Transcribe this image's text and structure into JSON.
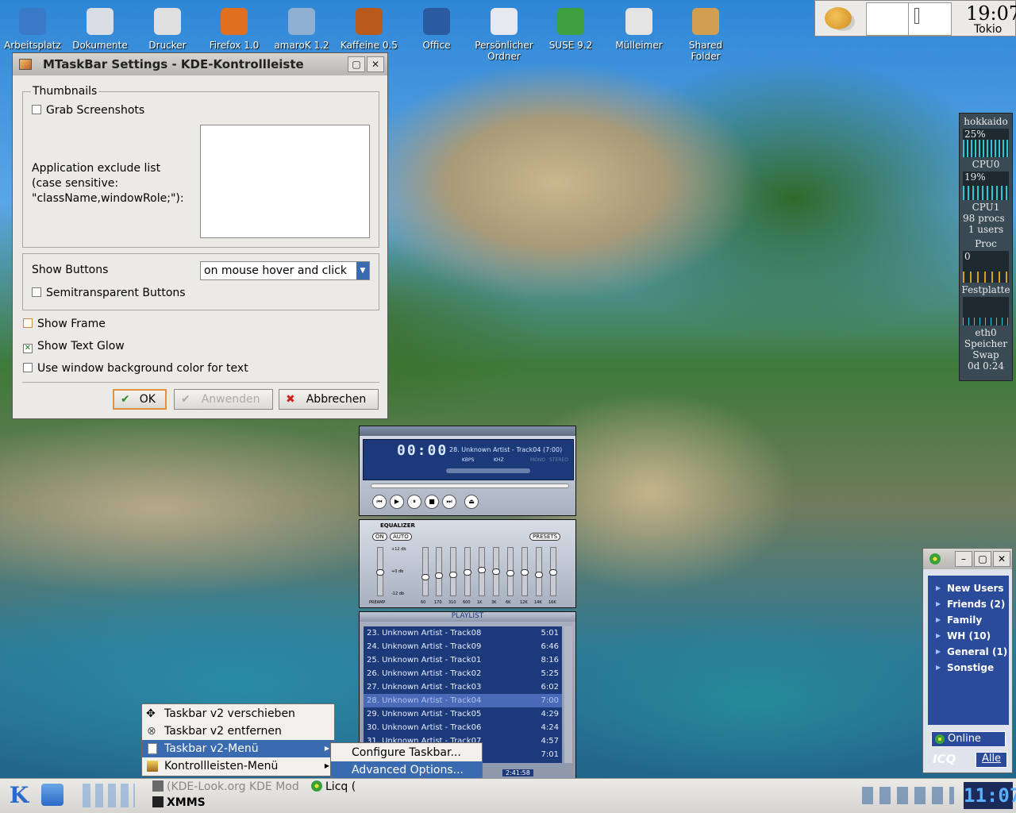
{
  "desktop_icons": [
    {
      "label": "Arbeitsplatz",
      "icon": "computer-icon",
      "color": "#3a78c8"
    },
    {
      "label": "Dokumente",
      "icon": "documents-icon",
      "color": "#d8dde6"
    },
    {
      "label": "Drucker",
      "icon": "printer-icon",
      "color": "#e0e0e0"
    },
    {
      "label": "Firefox 1.0",
      "icon": "firefox-icon",
      "color": "#e07020"
    },
    {
      "label": "amaroK 1.2",
      "icon": "amarok-icon",
      "color": "#8fb0d0"
    },
    {
      "label": "Kaffeine 0.5",
      "icon": "kaffeine-icon",
      "color": "#b85a1a"
    },
    {
      "label": "Office",
      "icon": "office-icon",
      "color": "#2a5aa0"
    },
    {
      "label": "Persönlicher Ordner",
      "icon": "home-icon",
      "color": "#e8e8f0"
    },
    {
      "label": "SUSE 9.2",
      "icon": "suse-icon",
      "color": "#3fa03f"
    },
    {
      "label": "Mülleimer",
      "icon": "trash-icon",
      "color": "#e4e4e4"
    },
    {
      "label": "Shared Folder",
      "icon": "shared-folder-icon",
      "color": "#d0a050"
    }
  ],
  "top_clock": {
    "time": "19:07",
    "city": "Tokio"
  },
  "dialog": {
    "title": "MTaskBar Settings - KDE-Kontrollleiste",
    "thumbnails_legend": "Thumbnails",
    "grab_screenshots": "Grab Screenshots",
    "exclude_label_1": "Application exclude list",
    "exclude_label_2": "(case sensitive:",
    "exclude_label_3": "\"className,windowRole;\"):",
    "show_buttons_label": "Show Buttons",
    "show_buttons_value": "on mouse hover and click",
    "semitransparent": "Semitransparent Buttons",
    "show_frame": "Show Frame",
    "show_text_glow": "Show Text Glow",
    "use_window_bg": "Use window background color for text",
    "ok": "OK",
    "apply": "Anwenden",
    "cancel": "Abbrechen"
  },
  "monitor": {
    "host": "hokkaido",
    "cpu0_pct": "25%",
    "cpu0": "CPU0",
    "cpu1_pct": "19%",
    "cpu1": "CPU1",
    "procs": "98 procs",
    "users": "1 users",
    "proc": "Proc",
    "disk_val": "0",
    "disk": "Festplatte",
    "net": "eth0",
    "mem": "Speicher",
    "swap": "Swap",
    "uptime": "0d 0:24"
  },
  "xmms": {
    "time": "00:00",
    "song": "28. Unknown Artist - Track04 (7:00)",
    "kbps": "KBPS",
    "khz": "KHZ",
    "mono": "MONO",
    "stereo": "STEREO",
    "eq_title": "EQUALIZER",
    "eq_on": "ON",
    "eq_auto": "AUTO",
    "eq_presets": "PRESETS",
    "eq_plus": "+12 db",
    "eq_zero": "+0 db",
    "eq_minus": "-12 db",
    "eq_preamp": "PREAMP",
    "eq_bands": [
      "60",
      "170",
      "310",
      "600",
      "1K",
      "3K",
      "6K",
      "12K",
      "14K",
      "16K"
    ],
    "eq_levels": [
      0.5,
      0.38,
      0.42,
      0.45,
      0.5,
      0.55,
      0.52,
      0.48,
      0.5,
      0.45,
      0.5
    ],
    "playlist_title": "PLAYLIST",
    "playlist": [
      {
        "title": "23. Unknown Artist - Track08",
        "len": "5:01"
      },
      {
        "title": "24. Unknown Artist - Track09",
        "len": "6:46"
      },
      {
        "title": "25. Unknown Artist - Track01",
        "len": "8:16"
      },
      {
        "title": "26. Unknown Artist - Track02",
        "len": "5:25"
      },
      {
        "title": "27. Unknown Artist - Track03",
        "len": "6:02"
      },
      {
        "title": "28. Unknown Artist - Track04",
        "len": "7:00"
      },
      {
        "title": "29. Unknown Artist - Track05",
        "len": "4:29"
      },
      {
        "title": "30. Unknown Artist - Track06",
        "len": "4:24"
      },
      {
        "title": "31. Unknown Artist - Track07",
        "len": "4:57"
      },
      {
        "title": "",
        "len": "7:01"
      }
    ],
    "pl_time": "2:41:58"
  },
  "icq": {
    "groups": [
      "New Users",
      "Friends (2)",
      "Family",
      "WH (10)",
      "General (1)",
      "Sonstige"
    ],
    "status": "Online",
    "logo": "ICQ",
    "all": "Alle"
  },
  "context_menu": {
    "items": [
      "Taskbar v2 verschieben",
      "Taskbar v2 entfernen",
      "Taskbar v2-Menü",
      "Kontrollleisten-Menü"
    ],
    "submenu": [
      "Configure Taskbar...",
      "Advanced Options..."
    ]
  },
  "taskbar": {
    "task1": "(KDE-Look.org KDE Mod",
    "task2": "Licq (",
    "task3": "XMMS",
    "clock": "11:07"
  }
}
